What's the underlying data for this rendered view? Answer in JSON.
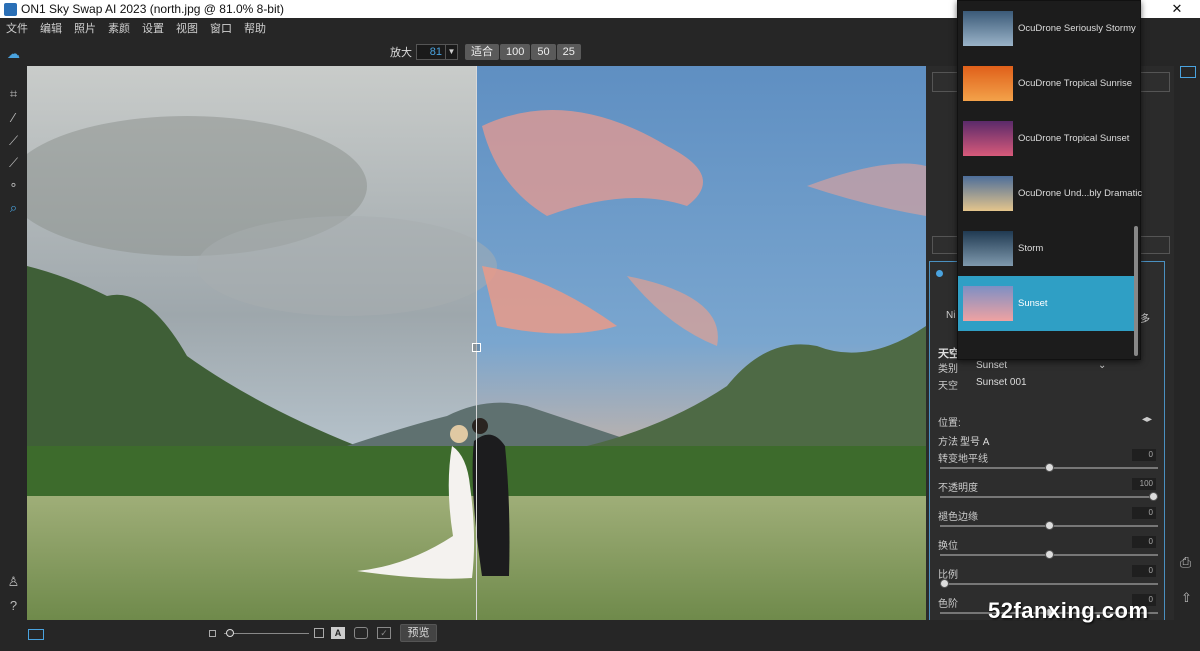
{
  "window": {
    "title": "ON1 Sky Swap AI 2023 (north.jpg @ 81.0% 8-bit)",
    "minimize": "—",
    "maximize": "□",
    "close": "✕"
  },
  "menu": [
    "文件",
    "编辑",
    "照片",
    "素颜",
    "设置",
    "视图",
    "窗口",
    "帮助"
  ],
  "zoom": {
    "label": "放大",
    "value": "81",
    "buttons": [
      "适合",
      "100",
      "50",
      "25"
    ]
  },
  "bottom": {
    "preview_label": "预览"
  },
  "sky_list": [
    {
      "name": "OcuDrone Seriously Stormy",
      "thumb": "stormy",
      "selected": false
    },
    {
      "name": "OcuDrone Tropical Sunrise",
      "thumb": "sunrise",
      "selected": false
    },
    {
      "name": "OcuDrone Tropical Sunset",
      "thumb": "tsunset",
      "selected": false
    },
    {
      "name": "OcuDrone Und...bly Dramatic",
      "thumb": "dramatic",
      "selected": false
    },
    {
      "name": "Storm",
      "thumb": "storm",
      "selected": false
    },
    {
      "name": "Sunset",
      "thumb": "sunset",
      "selected": true
    }
  ],
  "panel": {
    "truncated_label": "Ni",
    "truncated_right": "多",
    "section_title": "天空",
    "category_label": "类别",
    "category_value": "Sunset",
    "sky_label": "天空",
    "sky_value": "Sunset 001",
    "position_label": "位置:",
    "method_label": "方法",
    "method_value": "型号 A",
    "sliders": [
      {
        "label": "转变地平线",
        "value": "0",
        "level": 0.5
      },
      {
        "label": "不透明度",
        "value": "100",
        "level": 1.0
      },
      {
        "label": "褪色边缘",
        "value": "0",
        "level": 0.5
      },
      {
        "label": "换位",
        "value": "0",
        "level": 0.5
      },
      {
        "label": "比例",
        "value": "0",
        "level": 0.0
      },
      {
        "label": "色阶",
        "value": "0",
        "level": 0.5
      }
    ]
  },
  "watermark": "52fanxing.com",
  "colors": {
    "accent": "#2f9fc5",
    "panel_border": "#4a90c0"
  }
}
